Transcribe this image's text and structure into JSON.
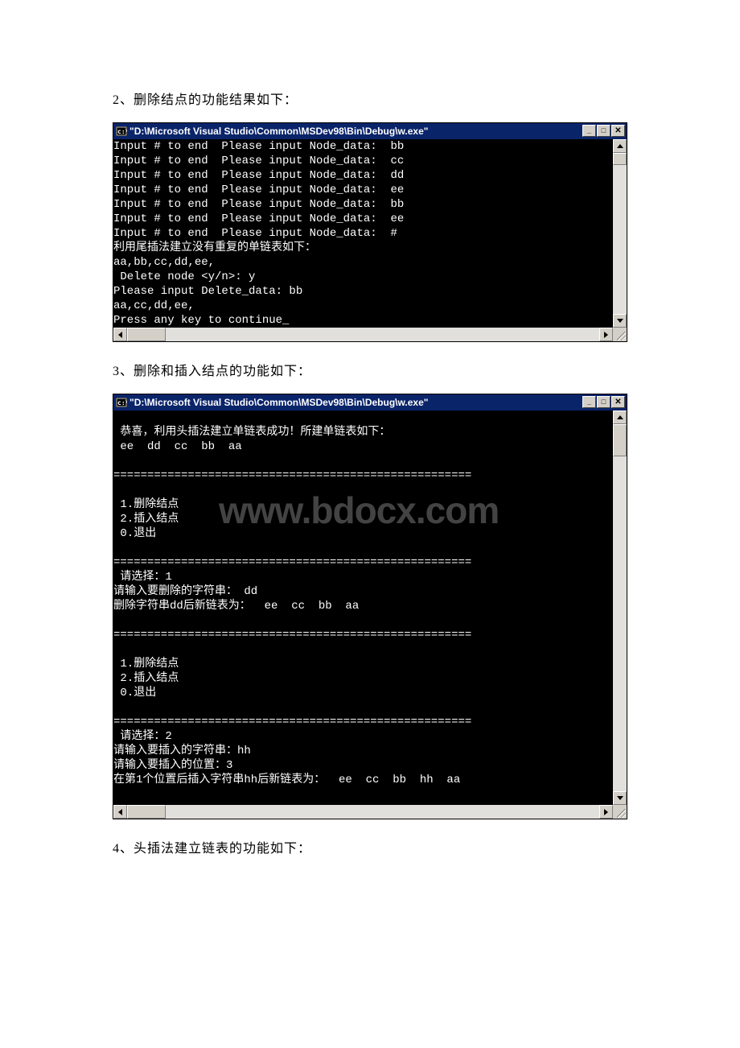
{
  "caption1": "2、删除结点的功能结果如下：",
  "caption2": "3、删除和插入结点的功能如下：",
  "caption3": "4、头插法建立链表的功能如下：",
  "watermark": "www.bdocx.com",
  "window1": {
    "title": "\"D:\\Microsoft Visual Studio\\Common\\MSDev98\\Bin\\Debug\\w.exe\"",
    "lines": [
      "Input # to end  Please input Node_data:  bb",
      "Input # to end  Please input Node_data:  cc",
      "Input # to end  Please input Node_data:  dd",
      "Input # to end  Please input Node_data:  ee",
      "Input # to end  Please input Node_data:  bb",
      "Input # to end  Please input Node_data:  ee",
      "Input # to end  Please input Node_data:  #",
      "利用尾插法建立没有重复的单链表如下：",
      "aa,bb,cc,dd,ee,",
      " Delete node <y/n>: y",
      "Please input Delete_data: bb",
      "aa,cc,dd,ee,",
      "Press any key to continue_"
    ]
  },
  "window2": {
    "title": "\"D:\\Microsoft Visual Studio\\Common\\MSDev98\\Bin\\Debug\\w.exe\"",
    "body": "\n 恭喜，利用头插法建立单链表成功！所建单链表如下：\n ee  dd  cc  bb  aa\n\n=====================================================\n\n 1.删除结点\n 2.插入结点\n 0.退出\n\n=====================================================\n 请选择：1\n请输入要删除的字符串： dd\n删除字符串dd后新链表为：  ee  cc  bb  aa\n\n=====================================================\n\n 1.删除结点\n 2.插入结点\n 0.退出\n\n=====================================================\n 请选择：2\n请输入要插入的字符串：hh\n请输入要插入的位置：3\n在第1个位置后插入字符串hh后新链表为：  ee  cc  bb  hh  aa\n"
  }
}
